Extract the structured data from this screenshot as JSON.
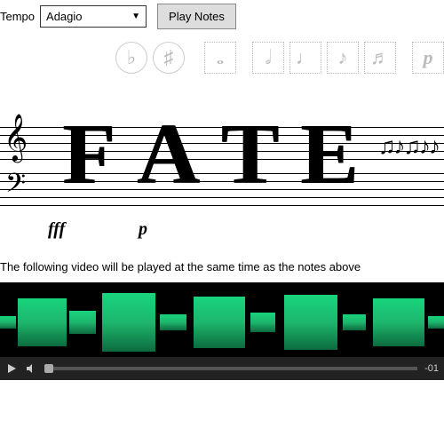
{
  "controls": {
    "tempo_label": "Tempo",
    "tempo_value": "Adagio",
    "play_label": "Play Notes"
  },
  "toolbar": {
    "flat_label": "♭",
    "sharp_label": "♯",
    "whole_label": "𝅝",
    "half_label": "𝅗𝅥",
    "quarter_label": "♩",
    "eighth_label": "♪",
    "sixteenth_label": "♬",
    "dynamic_label": "p"
  },
  "score": {
    "dynamics_fff": "fff",
    "dynamics_p": "p",
    "clef_treble": "𝄞",
    "clef_bass": "𝄢",
    "word": "FATE",
    "trailing_notes": "♫♪♫♪♪"
  },
  "caption": "The following video will be played at the same time as the notes above",
  "video": {
    "time_remaining": "-01"
  }
}
